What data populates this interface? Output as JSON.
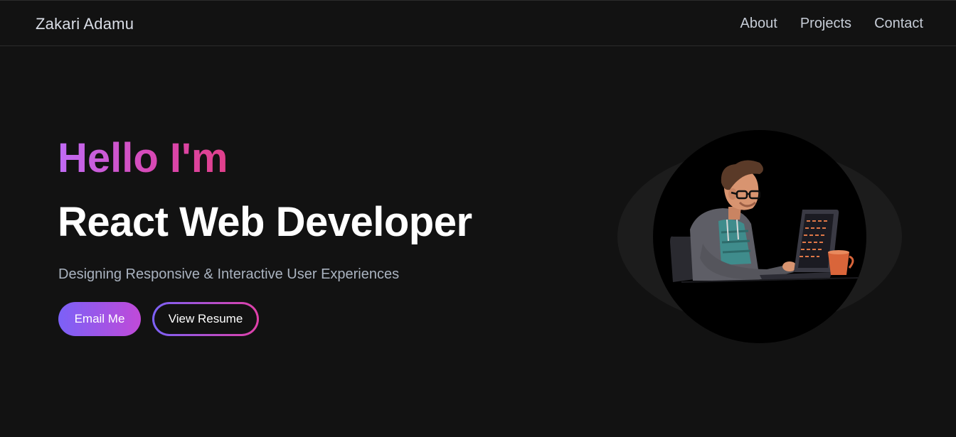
{
  "brand": "Zakari Adamu",
  "nav": {
    "links": [
      "About",
      "Projects",
      "Contact"
    ]
  },
  "hero": {
    "greeting": "Hello I'm",
    "title": "React Web Developer",
    "subtitle": "Designing Responsive & Interactive User Experiences",
    "buttons": {
      "email": "Email Me",
      "resume": "View Resume"
    }
  },
  "colors": {
    "background": "#121212",
    "gradient_start": "#7b61f7",
    "gradient_end": "#e040a8"
  },
  "icons": {
    "hero_image": "developer-at-laptop-illustration"
  }
}
